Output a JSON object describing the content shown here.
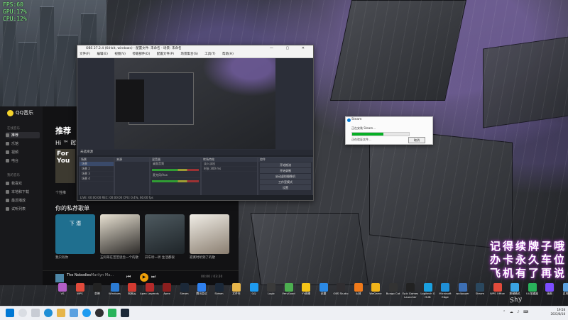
{
  "fps_overlay": [
    "FPS:60",
    "GPU:17%",
    "CPU:12%"
  ],
  "qq_music": {
    "app_name": "QQ音乐",
    "nav": [
      "推荐",
      "乐馆",
      "视频",
      "电台",
      "我喜欢",
      "本地和下载",
      "最近播放",
      "试听列表"
    ],
    "section_label": "我的音乐",
    "heading": "推荐",
    "greeting": "Hi ™ 晖汗",
    "for_you": "For You",
    "tip": "个性推",
    "subheading": "你的私荐歌单",
    "cards": [
      {
        "caption": "我只有你",
        "color": "#1f6f8f",
        "text": "下 潜"
      },
      {
        "caption": "五阿哥在苦苦思念一个的歌",
        "color": "#2c2a28",
        "text": ""
      },
      {
        "caption": "开车听一听 生活都很",
        "color": "#2e3a40",
        "text": ""
      },
      {
        "caption": "寂寞时听到了的歌",
        "color": "#d8d4cc",
        "text": ""
      }
    ],
    "player": {
      "song": "The Nobodies",
      "artist": "Marilyn Ma...",
      "time": "00:00 / 03:20"
    }
  },
  "obs": {
    "title": "OBS 27.2.4 (64-bit, windows) - 配置文件: 未命名 - 场景: 未命名",
    "menu": [
      "文件(F)",
      "编辑(E)",
      "视图(V)",
      "停靠部件(D)",
      "配置文件(P)",
      "场景集合(S)",
      "工具(T)",
      "帮助(H)"
    ],
    "toolbar_label": "未选择源",
    "docks": {
      "scenes": {
        "title": "场景",
        "items": [
          "场景",
          "场景 2",
          "场景 3",
          "场景 4"
        ]
      },
      "sources": {
        "title": "来源",
        "items": []
      },
      "mixer": {
        "title": "混音器",
        "items": [
          "桌面音频",
          "麦克风/Aux"
        ]
      },
      "transitions": {
        "title": "转场特效",
        "items": [
          "淡入淡出",
          "时长 300 ms"
        ]
      },
      "controls": {
        "title": "控件",
        "buttons": [
          "开始推流",
          "开始录制",
          "启动虚拟摄像机",
          "工作室模式",
          "设置",
          "退出"
        ]
      }
    },
    "status": "LIVE: 00:00:00   REC: 00:00:00   CPU: 0.4%, 60.00 fps"
  },
  "install_dialog": {
    "title": "Steam",
    "line1": "正在安装 Steam...",
    "line2": "正在验证文件...",
    "cancel": "取消",
    "progress": 0.55
  },
  "desktop_icons": [
    {
      "label": "VS",
      "color": "#b45ec8"
    },
    {
      "label": "WPS",
      "color": "#e24a3b"
    },
    {
      "label": "剪映",
      "color": "#222222"
    },
    {
      "label": "Windows",
      "color": "#2b7bd3"
    },
    {
      "label": "网易云",
      "color": "#d33a31"
    },
    {
      "label": "Apex Legends",
      "color": "#b52a2a"
    },
    {
      "label": "Apex",
      "color": "#8b1e1e"
    },
    {
      "label": "Steam",
      "color": "#1b2838"
    },
    {
      "label": "腾讯会议",
      "color": "#2f80ed"
    },
    {
      "label": "Steam",
      "color": "#1b2838"
    },
    {
      "label": "文件夹",
      "color": "#e6b54a"
    },
    {
      "label": "QQ",
      "color": "#1e9bf0"
    },
    {
      "label": "Logic",
      "color": "#3a3a3a"
    },
    {
      "label": "VeryGood",
      "color": "#4caf50"
    },
    {
      "label": "YY直播",
      "color": "#f5c518"
    },
    {
      "label": "迅雷",
      "color": "#2b8ae6"
    },
    {
      "label": "OBS Studio",
      "color": "#302e31"
    },
    {
      "label": "火绒",
      "color": "#f07a1a"
    },
    {
      "label": "WeGame",
      "color": "#f0b41a"
    },
    {
      "label": "Bungo Cat",
      "color": "#333333"
    },
    {
      "label": "Epic Games Launcher",
      "color": "#222222"
    },
    {
      "label": "Logitech G HUB",
      "color": "#1aa0e0"
    },
    {
      "label": "Microsoft Edge",
      "color": "#1f8fd6"
    },
    {
      "label": "wallpaper",
      "color": "#3d6fb4"
    },
    {
      "label": "Steam",
      "color": "#2a475e"
    },
    {
      "label": "WPS Office",
      "color": "#e24a3b"
    },
    {
      "label": "按键精灵",
      "color": "#3aa3e3"
    },
    {
      "label": "UU加速器",
      "color": "#29b35b"
    },
    {
      "label": "画图",
      "color": "#7c4dff"
    },
    {
      "label": "此电脑",
      "color": "#5aa0e0"
    }
  ],
  "lyric": {
    "line1": "记得续牌子哦",
    "line2": "办卡永久车位",
    "line3": "飞机有了再说"
  },
  "taskbar": {
    "time": "19:58",
    "date": "2022/8/18",
    "apps": [
      "windows-icon",
      "search-icon",
      "taskview-icon",
      "edge-icon",
      "explorer-icon",
      "store-icon",
      "qq-icon",
      "obs-icon",
      "wechat-icon",
      "steam-icon"
    ]
  }
}
